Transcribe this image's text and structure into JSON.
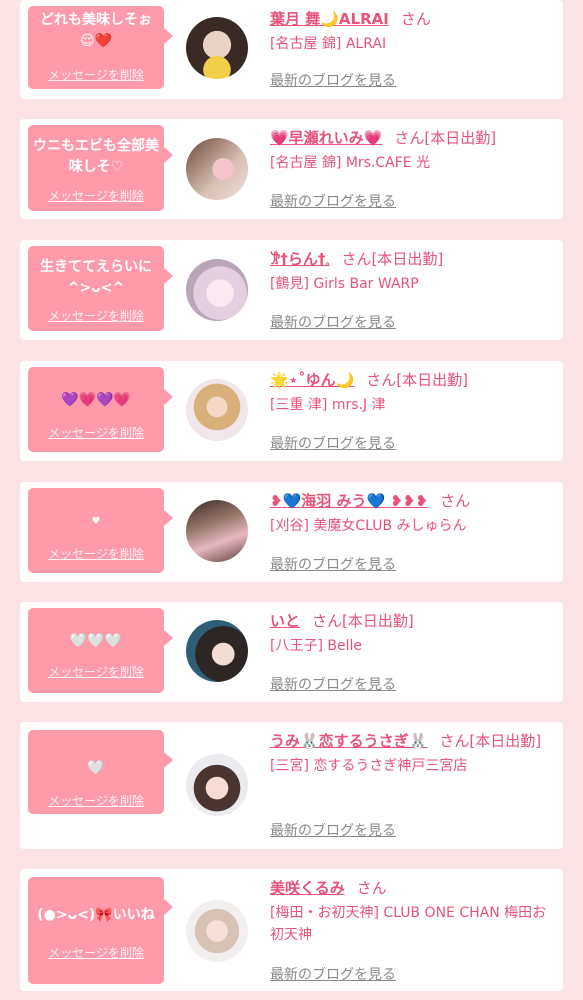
{
  "delete_label": "メッセージを削除",
  "blog_label": "最新のブログを見る",
  "colors": {
    "background": "#fbe3e6",
    "bubble": "#ff9aab",
    "name": "#e8537a",
    "blog_link": "#8a8a8a"
  },
  "entries": [
    {
      "message": "どれも美味しそぉ 😌❤️",
      "name": "葉月 舞🌙ALRAI",
      "san": "さん",
      "shop": "[名古屋 錦] ALRAI"
    },
    {
      "message": "ウニもエビも全部美味しそ♡",
      "name": "💗早瀬れいみ💗",
      "san": "さん[本日出勤]",
      "shop": "[名古屋 錦] Mrs.CAFE 光"
    },
    {
      "message": "生きててえらいに ^>ᴗ<^",
      "name": "𐦂†らん†𓈒",
      "san": "さん[本日出勤]",
      "shop": "[鶴見] Girls Bar WARP"
    },
    {
      "message": "💜💗💜💗",
      "name": "🌟⋆˚ゆん🌙",
      "san": "さん[本日出勤]",
      "shop": "[三重 津] mrs.J 津"
    },
    {
      "message": "♥",
      "name": "❥💙海羽 みう💙 ❥❥❥",
      "san": "さん",
      "shop": "[刈谷] 美魔女CLUB みしゅらん"
    },
    {
      "message": "🤍🤍🤍",
      "name": "いと",
      "san": "さん[本日出勤]",
      "shop": "[八王子] Belle"
    },
    {
      "message": "🤍",
      "name": "うみ🐰恋するうさぎ🐰",
      "san": "さん[本日出勤]",
      "shop": "[三宮] 恋するうさぎ神戸三宮店"
    },
    {
      "message": "(●>ᴗ<)🎀いいね",
      "name": "美咲くるみ",
      "san": "さん",
      "shop": "[梅田・お初天神] CLUB ONE CHAN 梅田お初天神"
    }
  ]
}
